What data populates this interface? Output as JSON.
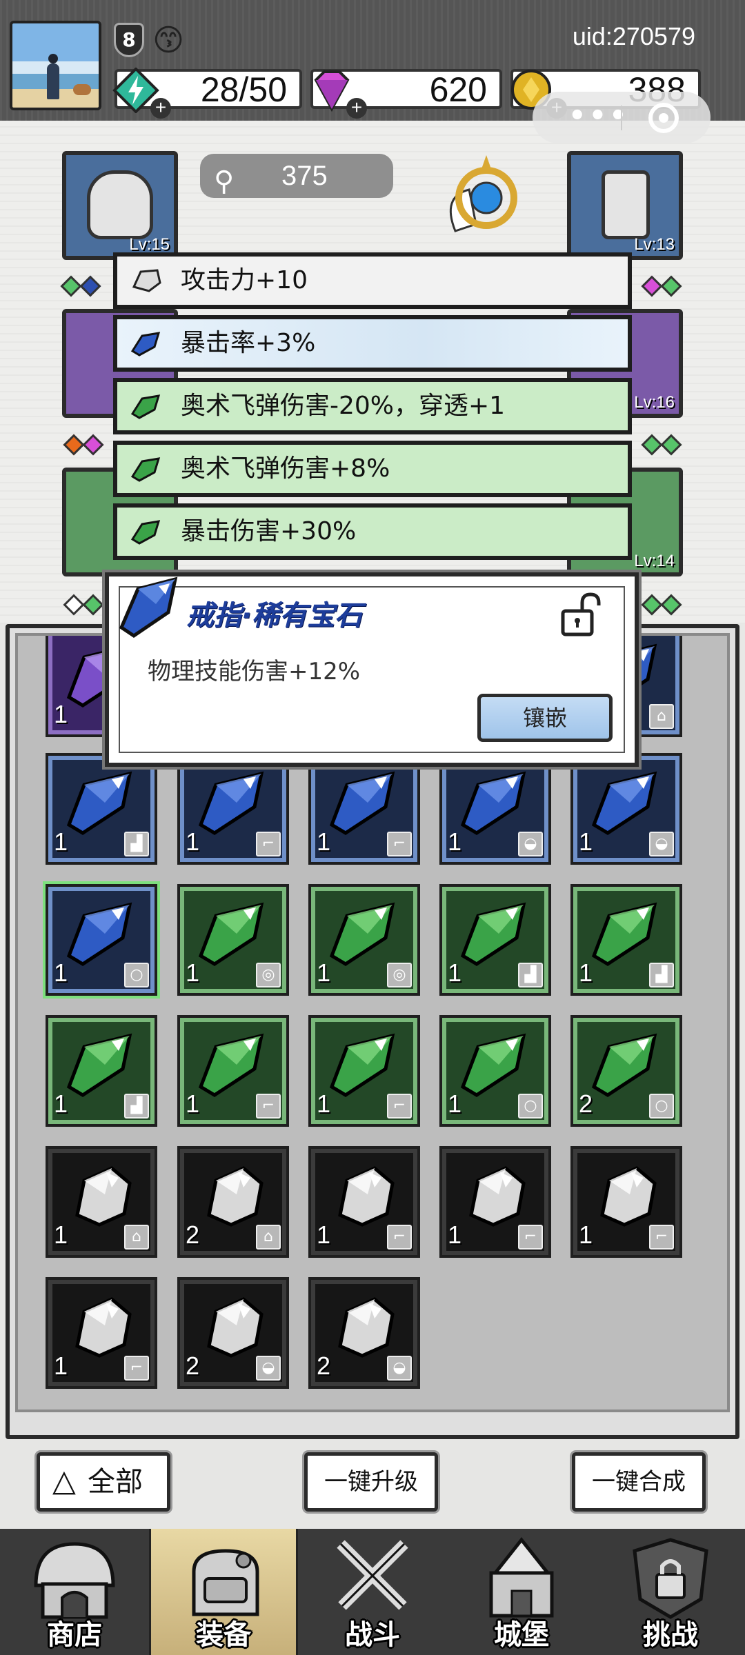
{
  "header": {
    "level": "8",
    "uid": "uid:270579",
    "energy": "28/50",
    "gems": "620",
    "gold": "388"
  },
  "equipment": {
    "key_count": "375",
    "slots": [
      {
        "id": "helmet",
        "level": "Lv:15"
      },
      {
        "id": "weapon",
        "level": "Lv:13"
      },
      {
        "id": "armor",
        "level": ""
      },
      {
        "id": "ring",
        "level": "Lv:16"
      },
      {
        "id": "boots",
        "level": ""
      },
      {
        "id": "necklace",
        "level": "Lv:14"
      }
    ]
  },
  "attributes": [
    {
      "text": "攻击力+10",
      "tier": "white"
    },
    {
      "text": "暴击率+3%",
      "tier": "blue"
    },
    {
      "text": "奥术飞弹伤害-20%，穿透+1",
      "tier": "green"
    },
    {
      "text": "奥术飞弹伤害+8%",
      "tier": "green"
    },
    {
      "text": "暴击伤害+30%",
      "tier": "green"
    }
  ],
  "tooltip": {
    "title": "戒指·稀有宝石",
    "description": "物理技能伤害+12%",
    "inlay_label": "镶嵌"
  },
  "inventory": [
    {
      "tier": "purple",
      "count": "1",
      "slot_icon": ""
    },
    {
      "tier": "blue",
      "count": "",
      "slot_icon": "armor"
    },
    {
      "tier": "blue",
      "count": "1",
      "slot_icon": "boots"
    },
    {
      "tier": "blue",
      "count": "1",
      "slot_icon": "weapon"
    },
    {
      "tier": "blue",
      "count": "1",
      "slot_icon": "weapon"
    },
    {
      "tier": "blue",
      "count": "1",
      "slot_icon": "helmet"
    },
    {
      "tier": "blue",
      "count": "1",
      "slot_icon": "helmet"
    },
    {
      "tier": "blue",
      "count": "1",
      "slot_icon": "ring"
    },
    {
      "tier": "green",
      "count": "1",
      "slot_icon": "necklace"
    },
    {
      "tier": "green",
      "count": "1",
      "slot_icon": "necklace"
    },
    {
      "tier": "green",
      "count": "1",
      "slot_icon": "boots"
    },
    {
      "tier": "green",
      "count": "1",
      "slot_icon": "boots"
    },
    {
      "tier": "green",
      "count": "1",
      "slot_icon": "boots"
    },
    {
      "tier": "green",
      "count": "1",
      "slot_icon": "weapon"
    },
    {
      "tier": "green",
      "count": "1",
      "slot_icon": "weapon"
    },
    {
      "tier": "green",
      "count": "1",
      "slot_icon": "ring"
    },
    {
      "tier": "green",
      "count": "2",
      "slot_icon": "ring"
    },
    {
      "tier": "grey",
      "count": "1",
      "slot_icon": "armor"
    },
    {
      "tier": "grey",
      "count": "2",
      "slot_icon": "armor"
    },
    {
      "tier": "grey",
      "count": "1",
      "slot_icon": "weapon"
    },
    {
      "tier": "grey",
      "count": "1",
      "slot_icon": "weapon"
    },
    {
      "tier": "grey",
      "count": "1",
      "slot_icon": "weapon"
    },
    {
      "tier": "grey",
      "count": "1",
      "slot_icon": "weapon"
    },
    {
      "tier": "grey",
      "count": "2",
      "slot_icon": "helmet"
    },
    {
      "tier": "grey",
      "count": "2",
      "slot_icon": "helmet"
    }
  ],
  "actions": {
    "all_label": "全部",
    "upgrade_label": "一键升级",
    "merge_label": "一键合成"
  },
  "nav": {
    "shop": "商店",
    "equipment": "装备",
    "battle": "战斗",
    "castle": "城堡",
    "challenge": "挑战"
  },
  "colors": {
    "rare_blue": "#1d3d9b",
    "tier_blue": "#6f90c9",
    "tier_green": "#79b77a",
    "tier_grey": "#3b3b3b",
    "tier_purple": "#8d6fc3",
    "nav_active": "#e8d8a4"
  }
}
